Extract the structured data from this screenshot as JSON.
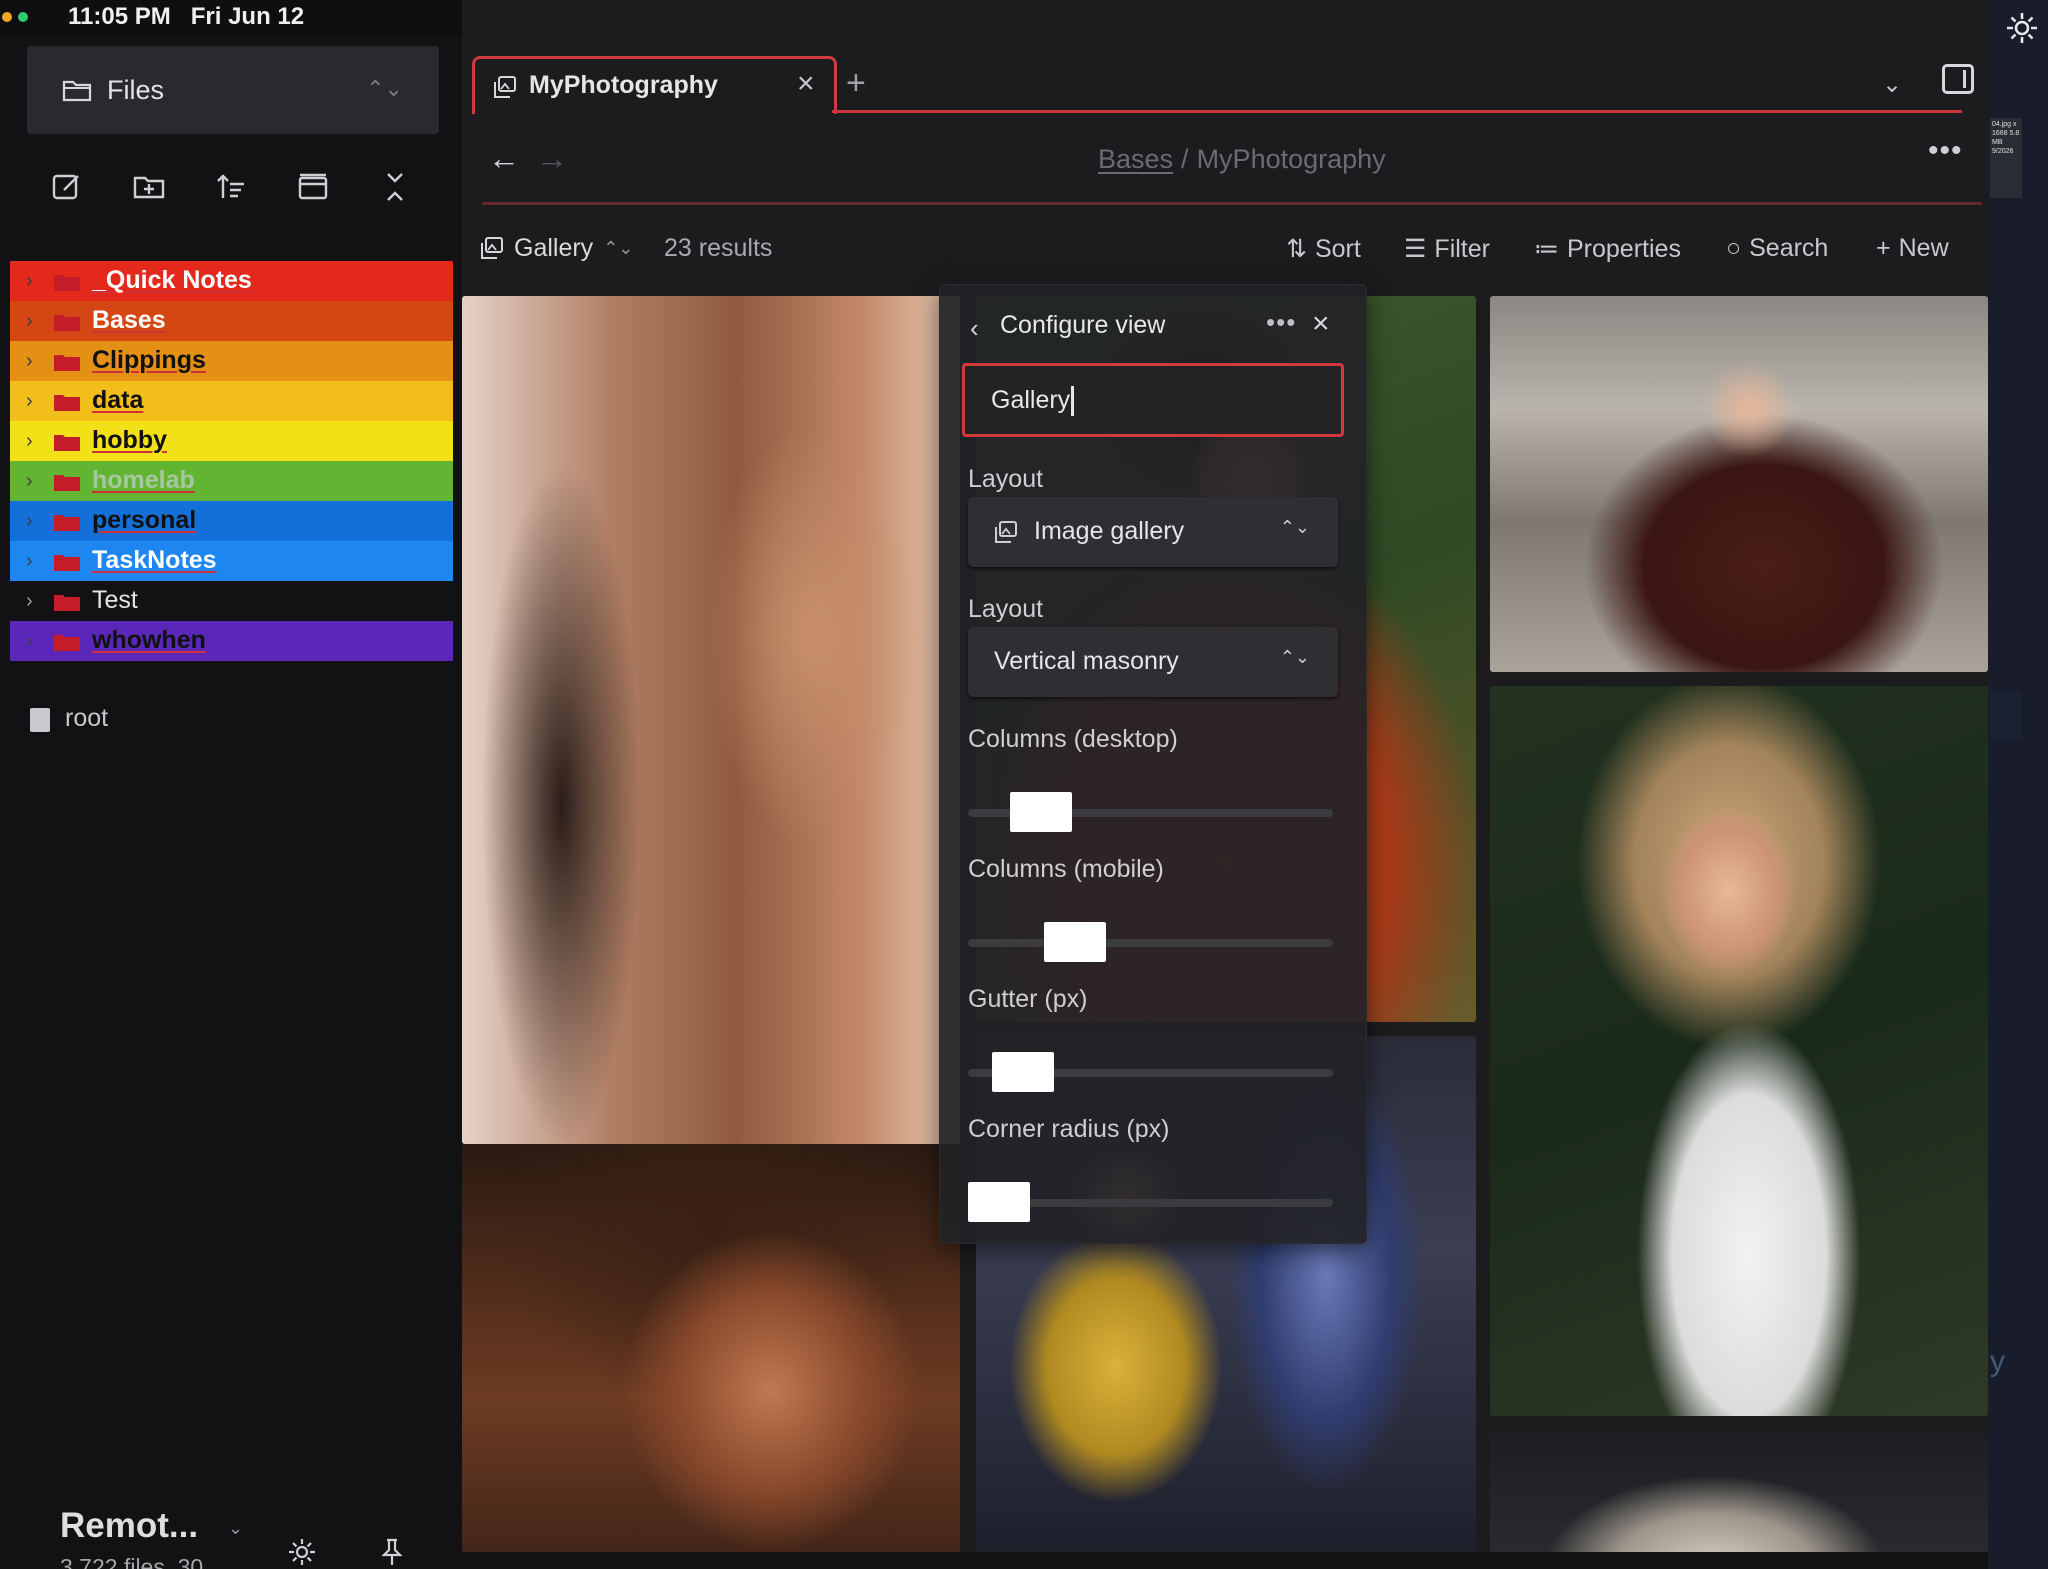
{
  "status_bar": {
    "time": "11:05 PM",
    "date": "Fri Jun 12",
    "dots": [
      "#f5a623",
      "#2ecc71"
    ]
  },
  "sidebar": {
    "switcher_label": "Files",
    "toolbar": [
      "new-note-icon",
      "new-folder-icon",
      "sort-icon",
      "collapse-all-icon",
      "close-expand-icon"
    ],
    "tree": [
      {
        "label": "_Quick Notes",
        "bg": "#e5281c",
        "text": "#ffffff"
      },
      {
        "label": "Bases",
        "bg": "#d44714",
        "text": "#ffffff"
      },
      {
        "label": "Clippings",
        "bg": "#e39014",
        "text": "#111111"
      },
      {
        "label": "data",
        "bg": "#f2be1a",
        "text": "#111111"
      },
      {
        "label": "hobby",
        "bg": "#f3e117",
        "text": "#111111"
      },
      {
        "label": "homelab",
        "bg": "#62b433",
        "text": "#a8c7a0"
      },
      {
        "label": "personal",
        "bg": "#1470d8",
        "text": "#111111"
      },
      {
        "label": "TaskNotes",
        "bg": "#1d86f0",
        "text": "#ffffff"
      },
      {
        "label": "Test",
        "bg": "",
        "text": "#e4e4e6"
      },
      {
        "label": "whowhen",
        "bg": "#5a27b8",
        "text": "#111111"
      }
    ],
    "root_label": "root",
    "vault_name": "Remot...",
    "vault_stats": "3,722 files, 30..."
  },
  "tab": {
    "title": "MyPhotography"
  },
  "breadcrumb": {
    "parent": "Bases",
    "separator": "/",
    "current": "MyPhotography"
  },
  "base_toolbar": {
    "view_name": "Gallery",
    "results": "23 results",
    "sort": "Sort",
    "filter": "Filter",
    "properties": "Properties",
    "search": "Search",
    "new": "New"
  },
  "configure_view": {
    "title": "Configure view",
    "view_name_value": "Gallery",
    "layout_label_1": "Layout",
    "layout_value_1": "Image gallery",
    "layout_label_2": "Layout",
    "layout_value_2": "Vertical masonry",
    "sliders": [
      {
        "label": "Columns (desktop)",
        "level": 0.14
      },
      {
        "label": "Columns (mobile)",
        "level": 0.25
      },
      {
        "label": "Gutter (px)",
        "level": 0.08
      },
      {
        "label": "Corner radius (px)",
        "level": 0.0
      }
    ]
  },
  "edge": {
    "thumb_text": "04.jpg x 1668 5.8 MB 9/2026"
  }
}
